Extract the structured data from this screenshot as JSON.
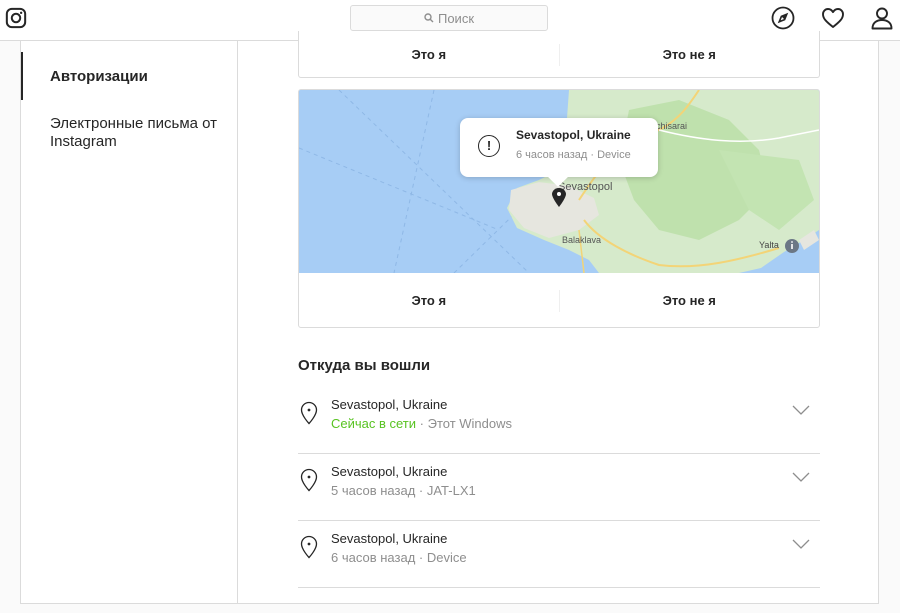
{
  "header": {
    "search_placeholder": "Поиск",
    "icons": [
      "instagram-logo-icon",
      "search-icon",
      "compass-icon",
      "heart-icon",
      "profile-icon"
    ]
  },
  "sidebar": {
    "items": [
      {
        "label": "Авторизации",
        "active": true
      },
      {
        "label": "Электронные письма от Instagram",
        "active": false
      }
    ]
  },
  "prev_card": {
    "confirm_label": "Это я",
    "deny_label": "Это не я"
  },
  "map_card": {
    "popup": {
      "title": "Sevastopol, Ukraine",
      "time": "6 часов назад",
      "device": "Device"
    },
    "map_labels": {
      "city": "Sevastopol",
      "balaklava": "Balaklava",
      "yalta": "Yalta",
      "bakhchisarai": "chisarai"
    },
    "confirm_label": "Это я",
    "deny_label": "Это не я"
  },
  "logins": {
    "title": "Откуда вы вошли",
    "items": [
      {
        "location": "Sevastopol, Ukraine",
        "status": "Сейчас в сети",
        "separator": " · ",
        "device": "Этот Windows"
      },
      {
        "location": "Sevastopol, Ukraine",
        "status": "5 часов назад",
        "separator": " · ",
        "device": "JAT-LX1"
      },
      {
        "location": "Sevastopol, Ukraine",
        "status": "6 часов назад",
        "separator": " · ",
        "device": "Device"
      }
    ]
  },
  "colors": {
    "online": "#58c322",
    "border": "#dbdbdb",
    "text": "#262626",
    "muted": "#8e8e8e",
    "water": "#a7cdf5",
    "land": "#d8eccb"
  }
}
